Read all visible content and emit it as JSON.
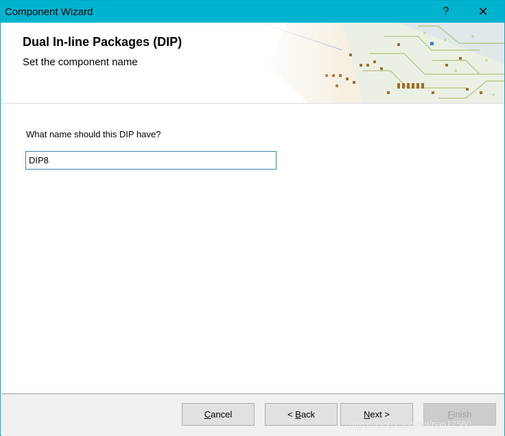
{
  "window": {
    "title": "Component Wizard",
    "help_glyph": "?",
    "close_glyph": "✕",
    "titlebar_color": "#00b4cf"
  },
  "header": {
    "title": "Dual In-line Packages (DIP)",
    "subtitle": "Set the component name"
  },
  "content": {
    "prompt": "What name should this DIP have?",
    "name_value": "DIP8"
  },
  "footer": {
    "cancel_label": "Cancel",
    "cancel_mnemonic": "C",
    "back_label": "< Back",
    "back_mnemonic": "B",
    "next_label": "Next >",
    "next_mnemonic": "N",
    "finish_label": "Finish",
    "finish_mnemonic": "F",
    "finish_enabled": false
  },
  "watermark": "https://blog.csdn.net/nan12580"
}
